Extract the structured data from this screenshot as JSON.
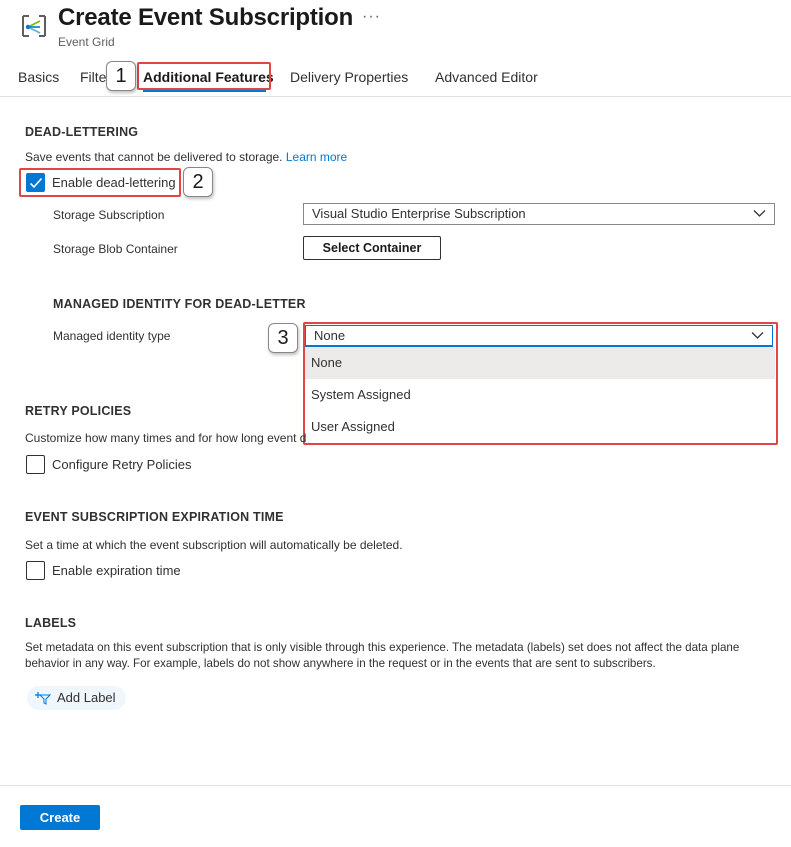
{
  "header": {
    "title": "Create Event Subscription",
    "subtitle": "Event Grid",
    "more_label": "···",
    "icon": "event-grid-icon"
  },
  "tabs": [
    {
      "label": "Basics"
    },
    {
      "label": "Filters"
    },
    {
      "label": "Additional Features",
      "selected": true
    },
    {
      "label": "Delivery Properties"
    },
    {
      "label": "Advanced Editor"
    }
  ],
  "callouts": [
    "1",
    "2",
    "3"
  ],
  "dead_lettering": {
    "title": "DEAD-LETTERING",
    "description": "Save events that cannot be delivered to storage.",
    "learn_more": "Learn more",
    "enable_label": "Enable dead-lettering",
    "enabled": true,
    "storage_subscription_label": "Storage Subscription",
    "storage_subscription_value": "Visual Studio Enterprise Subscription",
    "storage_blob_label": "Storage Blob Container",
    "select_container_label": "Select Container"
  },
  "managed_identity": {
    "title": "MANAGED IDENTITY FOR DEAD-LETTER",
    "type_label": "Managed identity type",
    "type_value": "None",
    "options": [
      "None",
      "System Assigned",
      "User Assigned"
    ]
  },
  "retry": {
    "title": "RETRY POLICIES",
    "description": "Customize how many times and for how long event d",
    "configure_label": "Configure Retry Policies",
    "checked": false
  },
  "expiration": {
    "title": "EVENT SUBSCRIPTION EXPIRATION TIME",
    "description": "Set a time at which the event subscription will automatically be deleted.",
    "enable_label": "Enable expiration time",
    "checked": false
  },
  "labels": {
    "title": "LABELS",
    "description_line1": "Set metadata on this event subscription that is only visible through this experience. The metadata (labels) set does not affect the data plane",
    "description_line2": "behavior in any way. For example, labels do not show anywhere in the request or in the events that are sent to subscribers.",
    "add_label": "Add Label"
  },
  "footer": {
    "create_label": "Create"
  },
  "colors": {
    "accent": "#0078d4",
    "highlight": "#e04646"
  }
}
